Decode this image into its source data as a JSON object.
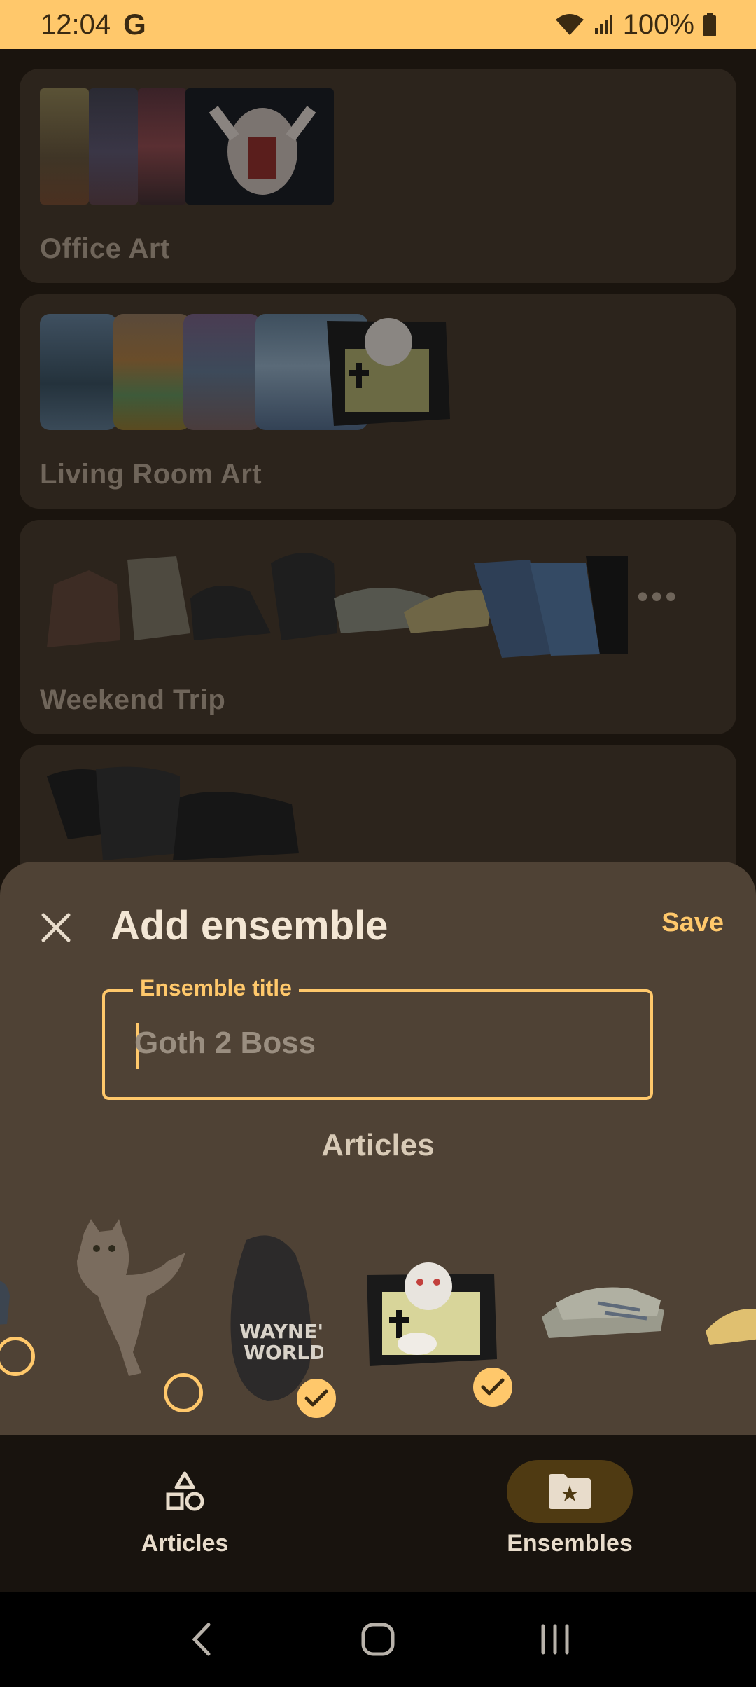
{
  "status_bar": {
    "time": "12:04",
    "g_icon": "google-icon",
    "battery": "100%"
  },
  "ensembles": [
    {
      "title": "Office Art"
    },
    {
      "title": "Living Room Art"
    },
    {
      "title": "Weekend Trip"
    },
    {
      "title": ""
    }
  ],
  "sheet": {
    "title": "Add ensemble",
    "save_label": "Save",
    "field_label": "Ensemble title",
    "field_value": "Goth 2 Boss",
    "articles_heading": "Articles",
    "articles": [
      {
        "icon": "shoe-icon",
        "selected": false
      },
      {
        "icon": "cat-icon",
        "selected": false
      },
      {
        "icon": "cap-icon",
        "selected": true
      },
      {
        "icon": "book-plate-icon",
        "selected": true
      },
      {
        "icon": "sneaker-icon",
        "selected": false
      },
      {
        "icon": "sneaker-icon",
        "selected": false
      }
    ]
  },
  "bottom_nav": {
    "items": [
      {
        "label": "Articles",
        "icon": "shapes-icon",
        "active": false
      },
      {
        "label": "Ensembles",
        "icon": "folder-star-icon",
        "active": true
      }
    ]
  },
  "colors": {
    "accent": "#ffc86b",
    "sheet_bg": "#4f4235",
    "card_bg": "#2c241c",
    "nav_active_bg": "#4f3a12"
  }
}
